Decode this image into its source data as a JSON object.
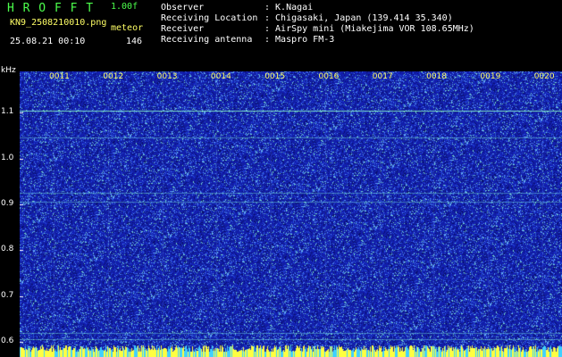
{
  "header": {
    "app_title": "H R O F F T",
    "version": "1.00f",
    "filename": "KN9_2508210010.png",
    "meteor_label": "meteor",
    "datetime": "25.08.21 00:10",
    "count": "146",
    "info": [
      {
        "key": "Observer",
        "value": ": K.Nagai"
      },
      {
        "key": "Receiving Location",
        "value": ": Chigasaki, Japan (139.414 35.340)"
      },
      {
        "key": "Receiver",
        "value": ": AirSpy mini (Miakejima VOR 108.65MHz)"
      },
      {
        "key": "Receiving antenna",
        "value": ": Maspro FM-3"
      }
    ]
  },
  "colors": {
    "background": "#000000",
    "waterfall_base": "#1a2aa8",
    "noise_light": "#6fb0ff",
    "noise_cyan": "#5fe0d0",
    "signal_line": "#7cffc0",
    "bottom_band": "#ffff40"
  },
  "chart_data": {
    "type": "heatmap",
    "title": "",
    "xlabel": "",
    "ylabel": "kHz",
    "y_ticks": [
      "1.1",
      "1.0",
      "0.9",
      "0.8",
      "0.7",
      "0.6"
    ],
    "x_ticks": [
      "0011",
      "0012",
      "0013",
      "0014",
      "0015",
      "0016",
      "0017",
      "0018",
      "0019",
      "0020"
    ],
    "ylim": [
      0.59,
      1.19
    ],
    "x_range_minutes": [
      10,
      20
    ],
    "signal_lines_khz": [
      1.105,
      1.045,
      0.925,
      0.905,
      0.62,
      0.605
    ],
    "grid": true
  }
}
